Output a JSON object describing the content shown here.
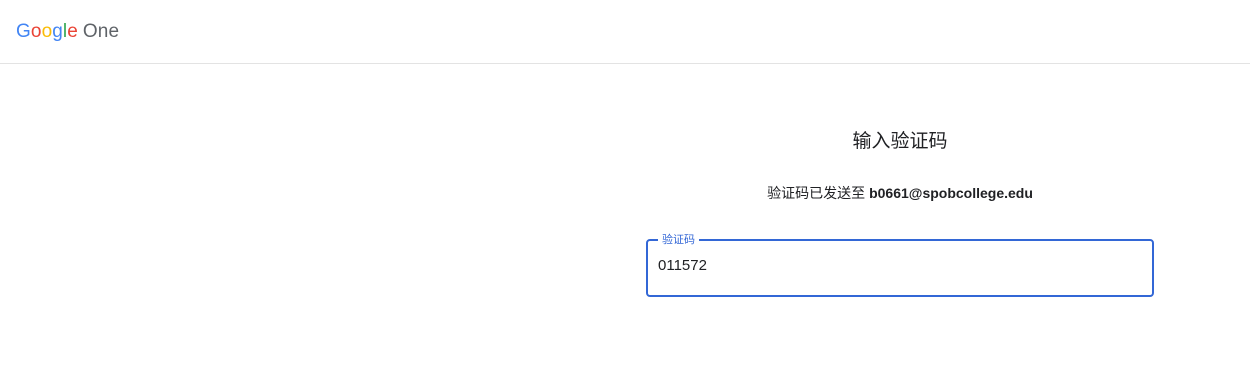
{
  "header": {
    "logo": {
      "letters": [
        "G",
        "o",
        "o",
        "g",
        "l",
        "e"
      ],
      "product": "One"
    }
  },
  "verify": {
    "title": "输入验证码",
    "subtitle_prefix": "验证码已发送至",
    "email": "b0661@spobcollege.edu",
    "field": {
      "label": "验证码",
      "value": "011572"
    }
  },
  "colors": {
    "accent": "#3367d6",
    "google_blue": "#4285f4",
    "google_red": "#ea4335",
    "google_yellow": "#fbbc05",
    "google_green": "#34a853"
  }
}
